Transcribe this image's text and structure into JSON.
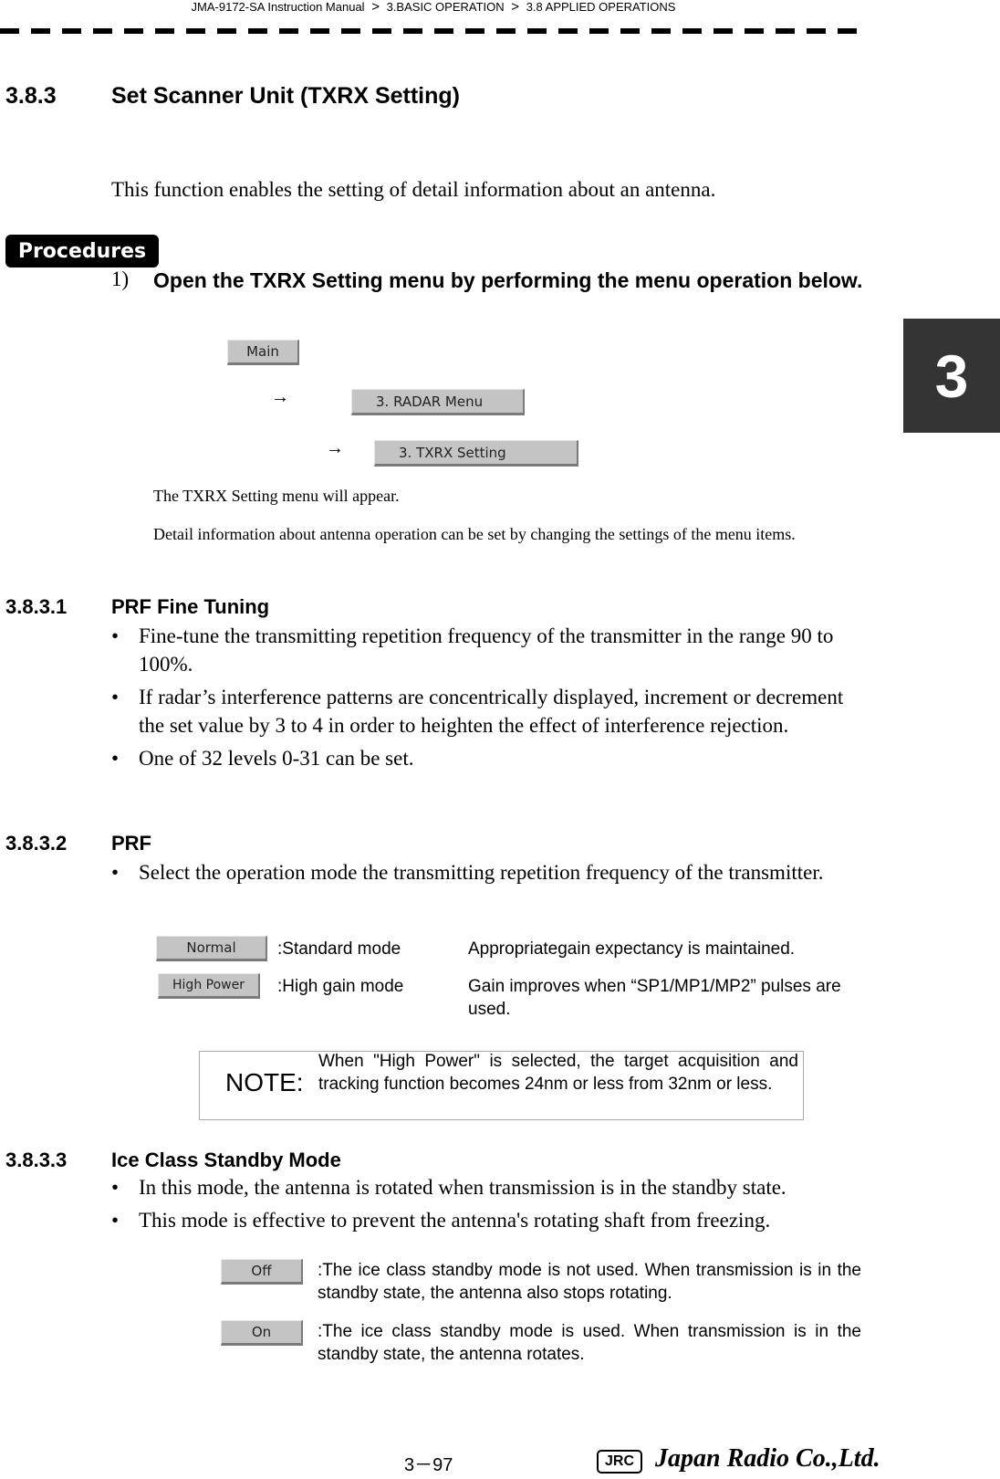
{
  "header": {
    "breadcrumb": [
      "JMA-9172-SA Instruction Manual",
      "3.BASIC OPERATION",
      "3.8  APPLIED OPERATIONS"
    ],
    "separator": ">"
  },
  "chapter_tab": "3",
  "section": {
    "number": "3.8.3",
    "title": "Set Scanner Unit (TXRX Setting)",
    "intro": "This function enables the setting of detail information about an antenna."
  },
  "procedures": {
    "badge": "Procedures",
    "step1_number": "1)",
    "step1_text": " Open the TXRX Setting menu by performing the menu operation below.",
    "menu_path": [
      "Main",
      "3. RADAR Menu",
      "3. TXRX Setting"
    ],
    "arrow": "→",
    "result1": "The TXRX Setting menu will appear.",
    "result2": "Detail information about antenna operation can be set by changing the settings of the menu items."
  },
  "subsections": [
    {
      "number": "3.8.3.1",
      "title": "PRF Fine Tuning",
      "bullets": [
        "Fine-tune the transmitting repetition frequency of the transmitter in the range 90 to 100%.",
        "If radar’s interference patterns are concentrically displayed, increment or decrement the set value by 3 to 4 in order to heighten the effect of interference rejection.",
        "One of 32 levels 0-31 can be set."
      ]
    },
    {
      "number": "3.8.3.2",
      "title": "PRF",
      "bullets": [
        "Select the operation mode the transmitting repetition frequency of the transmitter."
      ],
      "options": [
        {
          "button": "Normal",
          "mode": ":Standard mode",
          "desc": "Appropriategain expectancy is maintained."
        },
        {
          "button": "High Power",
          "mode": ":High gain mode",
          "desc": "Gain improves when “SP1/MP1/MP2” pulses are used."
        }
      ],
      "note_label": "NOTE:",
      "note_text": "When \"High  Power\" is selected, the target acquisition and tracking function becomes 24nm or less from 32nm or less."
    },
    {
      "number": "3.8.3.3",
      "title": "Ice Class Standby Mode",
      "bullets": [
        "In this mode, the antenna is rotated when transmission is in the standby state.",
        "This mode is effective to prevent the antenna's rotating shaft from freezing."
      ],
      "options": [
        {
          "button": "Off",
          "desc": ":The ice class standby mode is not used. When transmission is in the standby state, the antenna also stops rotating."
        },
        {
          "button": "On",
          "desc": ":The ice class standby mode is used. When transmission is in the standby state, the antenna rotates."
        }
      ]
    }
  ],
  "footer": {
    "page_number": "3－97",
    "logo_badge": "JRC",
    "company": "Japan Radio Co.,Ltd."
  }
}
